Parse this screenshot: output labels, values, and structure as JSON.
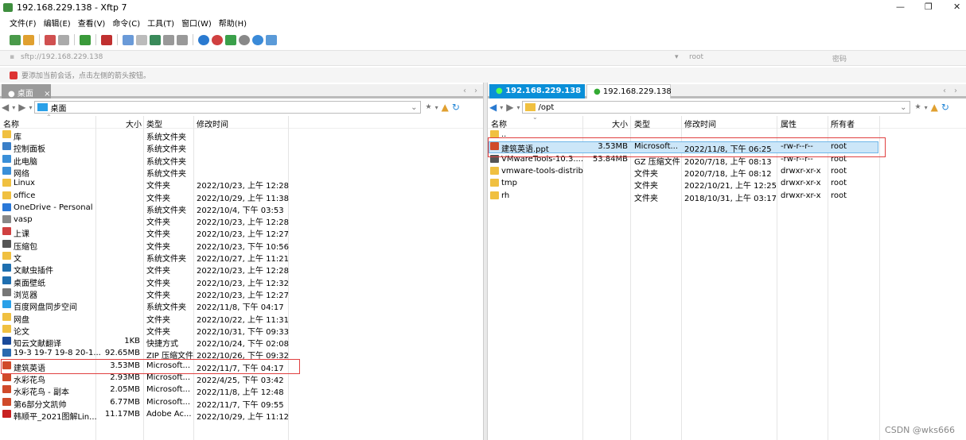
{
  "window": {
    "title": "192.168.229.138 - Xftp 7"
  },
  "menu": [
    "文件(F)",
    "编辑(E)",
    "查看(V)",
    "命令(C)",
    "工具(T)",
    "窗口(W)",
    "帮助(H)"
  ],
  "address": {
    "host_placeholder": "sftp://192.168.229.138",
    "user_placeholder": "root",
    "password_placeholder": "密码"
  },
  "hint": "要添加当前会话，点击左侧的箭头按钮。",
  "left": {
    "tab": "桌面",
    "path": "桌面",
    "columns": [
      "名称",
      "大小",
      "类型",
      "修改时间"
    ],
    "files": [
      {
        "name": "库",
        "size": "",
        "type": "系统文件夹",
        "date": "",
        "icon": "folder-icon",
        "color": "#f0c040"
      },
      {
        "name": "控制面板",
        "size": "",
        "type": "系统文件夹",
        "date": "",
        "icon": "control-panel-icon",
        "color": "#3a7fc8"
      },
      {
        "name": "此电脑",
        "size": "",
        "type": "系统文件夹",
        "date": "",
        "icon": "computer-icon",
        "color": "#3a8fd8"
      },
      {
        "name": "网络",
        "size": "",
        "type": "系统文件夹",
        "date": "",
        "icon": "network-icon",
        "color": "#3a8fd8"
      },
      {
        "name": "Linux",
        "size": "",
        "type": "文件夹",
        "date": "2022/10/23, 上午 12:28",
        "icon": "folder-icon",
        "color": "#f0c040"
      },
      {
        "name": "office",
        "size": "",
        "type": "文件夹",
        "date": "2022/10/29, 上午 11:38",
        "icon": "folder-icon",
        "color": "#f0c040"
      },
      {
        "name": "OneDrive - Personal",
        "size": "",
        "type": "系统文件夹",
        "date": "2022/10/4, 下午 03:53",
        "icon": "cloud-icon",
        "color": "#2a78d8"
      },
      {
        "name": "vasp",
        "size": "",
        "type": "文件夹",
        "date": "2022/10/23, 上午 12:28",
        "icon": "folder-icon",
        "color": "#888888"
      },
      {
        "name": "上课",
        "size": "",
        "type": "文件夹",
        "date": "2022/10/23, 上午 12:27",
        "icon": "folder-icon",
        "color": "#d04040"
      },
      {
        "name": "压缩包",
        "size": "",
        "type": "文件夹",
        "date": "2022/10/23, 下午 10:56",
        "icon": "archive-folder-icon",
        "color": "#555555"
      },
      {
        "name": "文",
        "size": "",
        "type": "系统文件夹",
        "date": "2022/10/27, 上午 11:21",
        "icon": "folder-icon",
        "color": "#f0c040"
      },
      {
        "name": "文献虫插件",
        "size": "",
        "type": "文件夹",
        "date": "2022/10/23, 上午 12:28",
        "icon": "folder-icon",
        "color": "#1f6fb0"
      },
      {
        "name": "桌面壁纸",
        "size": "",
        "type": "文件夹",
        "date": "2022/10/23, 上午 12:32",
        "icon": "folder-icon",
        "color": "#1f6fb0"
      },
      {
        "name": "浏览器",
        "size": "",
        "type": "文件夹",
        "date": "2022/10/23, 上午 12:27",
        "icon": "folder-icon",
        "color": "#777777"
      },
      {
        "name": "百度网盘同步空间",
        "size": "",
        "type": "系统文件夹",
        "date": "2022/11/8, 下午 04:17",
        "icon": "baidu-cloud-icon",
        "color": "#2aa0e8"
      },
      {
        "name": "网盘",
        "size": "",
        "type": "文件夹",
        "date": "2022/10/22, 上午 11:31",
        "icon": "folder-icon",
        "color": "#f0c040"
      },
      {
        "name": "论文",
        "size": "",
        "type": "文件夹",
        "date": "2022/10/31, 下午 09:33",
        "icon": "folder-icon",
        "color": "#f0c040"
      },
      {
        "name": "知云文献翻译",
        "size": "1KB",
        "type": "快捷方式",
        "date": "2022/10/24, 下午 02:08",
        "icon": "shortcut-icon",
        "color": "#1a4a9a"
      },
      {
        "name": "19-3 19-7 19-8 20-1...",
        "size": "92.65MB",
        "type": "ZIP 压缩文件",
        "date": "2022/10/26, 下午 09:32",
        "icon": "zip-icon",
        "color": "#2a6ab0"
      },
      {
        "name": "建筑英语",
        "size": "3.53MB",
        "type": "Microsoft...",
        "date": "2022/11/7, 下午 04:17",
        "icon": "ppt-icon",
        "color": "#d04a2a"
      },
      {
        "name": "水彩花鸟",
        "size": "2.93MB",
        "type": "Microsoft...",
        "date": "2022/4/25, 下午 03:42",
        "icon": "ppt-icon",
        "color": "#d04a2a"
      },
      {
        "name": "水彩花鸟 - 副本",
        "size": "2.05MB",
        "type": "Microsoft...",
        "date": "2022/11/8, 上午 12:48",
        "icon": "ppt-icon",
        "color": "#d04a2a"
      },
      {
        "name": "第6部分文凯帅",
        "size": "6.77MB",
        "type": "Microsoft...",
        "date": "2022/11/7, 下午 09:55",
        "icon": "ppt-icon",
        "color": "#d04a2a"
      },
      {
        "name": "韩顺平_2021图解Lin...",
        "size": "11.17MB",
        "type": "Adobe Ac...",
        "date": "2022/10/29, 上午 11:12",
        "icon": "pdf-icon",
        "color": "#c82020"
      }
    ]
  },
  "right": {
    "tabs": [
      "192.168.229.138",
      "192.168.229.138"
    ],
    "path": "/opt",
    "columns": [
      "名称",
      "大小",
      "类型",
      "修改时间",
      "属性",
      "所有者"
    ],
    "files": [
      {
        "name": "..",
        "size": "",
        "type": "",
        "date": "",
        "attr": "",
        "owner": "",
        "icon": "parent-folder-icon",
        "color": "#f0c040"
      },
      {
        "name": "建筑英语.ppt",
        "size": "3.53MB",
        "type": "Microsoft...",
        "date": "2022/11/8, 下午 06:25",
        "attr": "-rw-r--r--",
        "owner": "root",
        "icon": "ppt-icon",
        "color": "#d04a2a"
      },
      {
        "name": "VMwareTools-10.3....",
        "size": "53.84MB",
        "type": "GZ 压缩文件",
        "date": "2020/7/18, 上午 08:13",
        "attr": "-rw-r--r--",
        "owner": "root",
        "icon": "gz-icon",
        "color": "#555555"
      },
      {
        "name": "vmware-tools-distrib",
        "size": "",
        "type": "文件夹",
        "date": "2020/7/18, 上午 08:12",
        "attr": "drwxr-xr-x",
        "owner": "root",
        "icon": "folder-icon",
        "color": "#f0c040"
      },
      {
        "name": "tmp",
        "size": "",
        "type": "文件夹",
        "date": "2022/10/21, 上午 12:25",
        "attr": "drwxr-xr-x",
        "owner": "root",
        "icon": "folder-icon",
        "color": "#f0c040"
      },
      {
        "name": "rh",
        "size": "",
        "type": "文件夹",
        "date": "2018/10/31, 上午 03:17",
        "attr": "drwxr-xr-x",
        "owner": "root",
        "icon": "folder-icon",
        "color": "#f0c040"
      }
    ]
  },
  "watermark": "CSDN @wks666"
}
